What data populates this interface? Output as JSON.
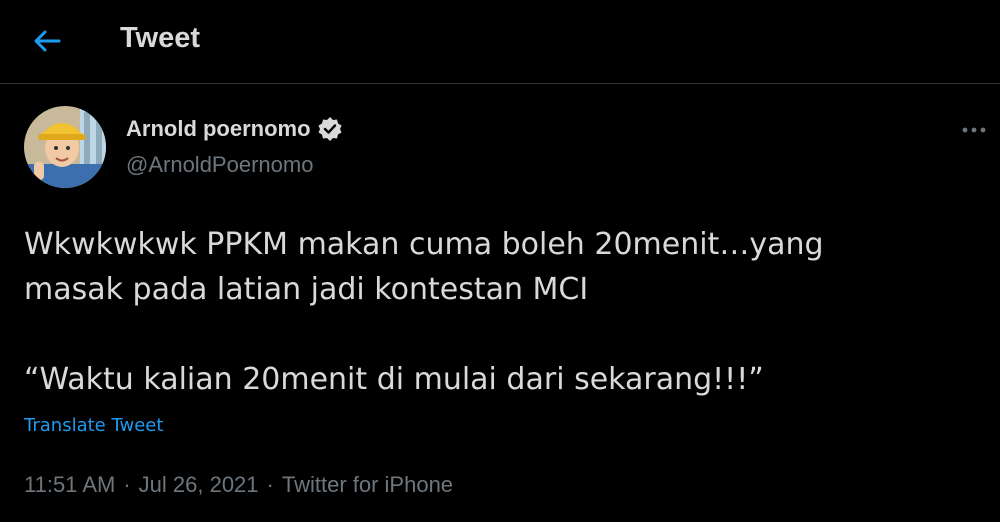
{
  "header": {
    "back_icon": "arrow-left-icon",
    "title": "Tweet"
  },
  "author": {
    "name": "Arnold poernomo",
    "handle": "@ArnoldPoernomo",
    "verified_icon": "verified-badge-icon"
  },
  "more_icon": "more-horizontal-icon",
  "tweet": {
    "text": "Wkwkwkwk PPKM makan cuma boleh 20menit…yang\nmasak pada latian jadi kontestan MCI\n\n“Waktu kalian 20menit di mulai dari sekarang!!!”",
    "translate_label": "Translate Tweet"
  },
  "meta": {
    "time": "11:51 AM",
    "separator": "·",
    "date": "Jul 26, 2021",
    "source": "Twitter for iPhone"
  },
  "colors": {
    "background": "#000000",
    "text": "#d9d9d9",
    "muted": "#6e767d",
    "accent": "#1d9bf0"
  }
}
